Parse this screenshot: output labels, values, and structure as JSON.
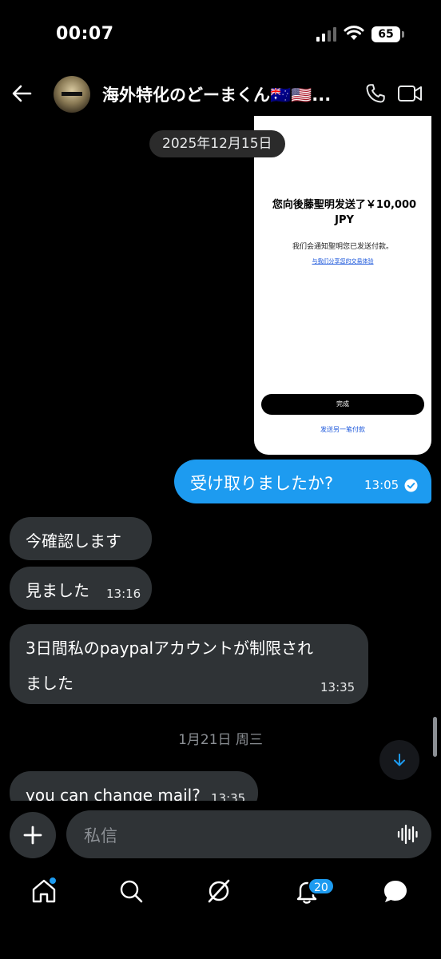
{
  "status_bar": {
    "time": "00:07",
    "battery": "65"
  },
  "header": {
    "title": "海外特化のどーまくん🇦🇺🇺🇸..."
  },
  "date_pill": "2025年12月15日",
  "image_card": {
    "sent_title": "您向後藤聖明发送了￥10,000 JPY",
    "notify": "我们会通知聖明您已发送付款。",
    "share_link": "与我们分享您的交易体验",
    "done_button": "完成",
    "another_link": "发送另一笔付款"
  },
  "messages": [
    {
      "direction": "out",
      "text": "受け取りましたか?",
      "time": "13:05"
    },
    {
      "direction": "in",
      "text": "今確認します",
      "time": ""
    },
    {
      "direction": "in",
      "text": "見ました",
      "time": "13:16"
    },
    {
      "direction": "in",
      "text_line1": "3日間私のpaypalアカウントが制限され",
      "text_line2": "ました",
      "time": "13:35"
    },
    {
      "direction": "in",
      "text": "you can change mail?",
      "time": "13:35"
    }
  ],
  "date_separator": "1月21日 周三",
  "composer": {
    "placeholder": "私信"
  },
  "tabbar": {
    "notifications_badge": "20"
  },
  "colors": {
    "accent": "#1d9bf0",
    "bubble_in": "#2f3336",
    "background": "#000000"
  },
  "icons": [
    "back-arrow-icon",
    "phone-icon",
    "video-icon",
    "check-icon",
    "arrow-down-icon",
    "plus-icon",
    "waveform-icon",
    "home-icon",
    "search-icon",
    "grok-icon",
    "bell-icon",
    "chat-icon"
  ]
}
